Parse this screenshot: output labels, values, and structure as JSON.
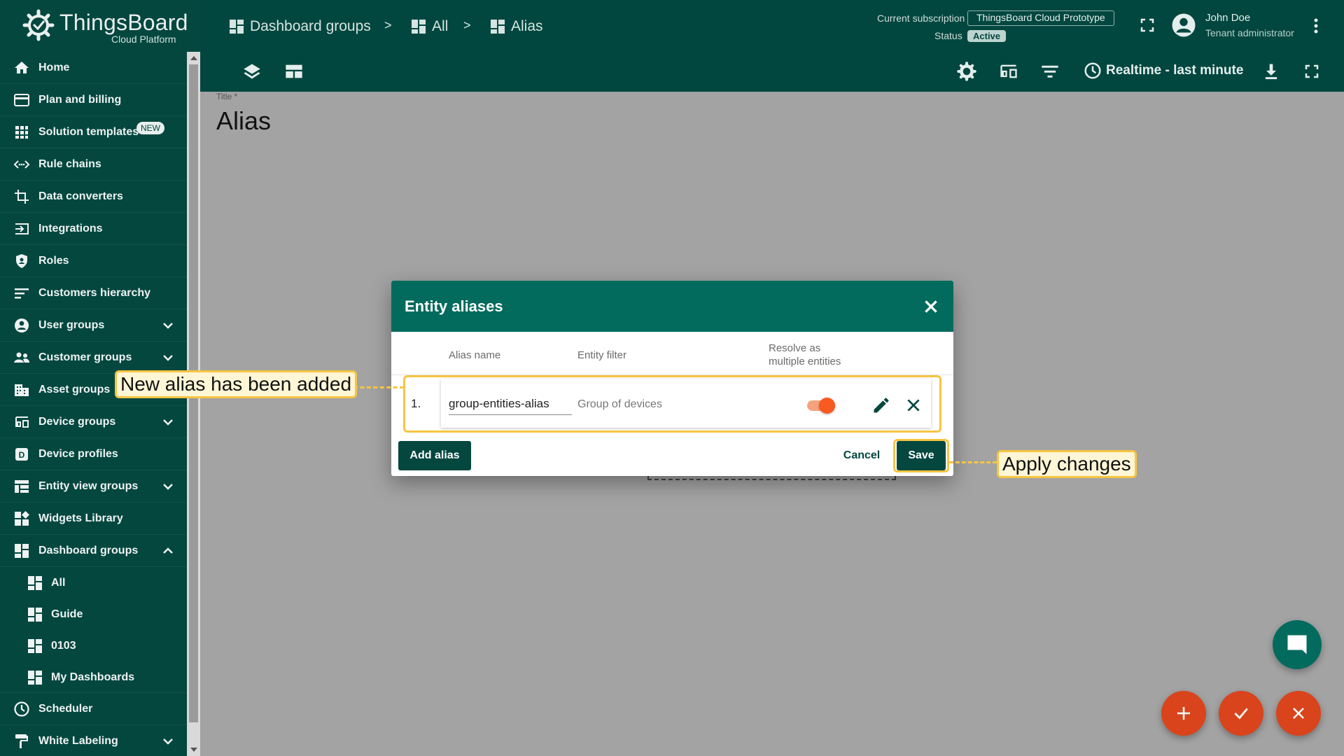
{
  "logo": {
    "name": "ThingsBoard",
    "subtitle": "Cloud Platform"
  },
  "sidebar": {
    "new_badge": "NEW",
    "items": [
      {
        "label": "Home",
        "icon": "home-icon"
      },
      {
        "label": "Plan and billing",
        "icon": "billing-icon"
      },
      {
        "label": "Solution templates",
        "icon": "apps-icon"
      },
      {
        "label": "Rule chains",
        "icon": "rule-chain-icon"
      },
      {
        "label": "Data converters",
        "icon": "converter-icon"
      },
      {
        "label": "Integrations",
        "icon": "integration-icon"
      },
      {
        "label": "Roles",
        "icon": "shield-icon"
      },
      {
        "label": "Customers hierarchy",
        "icon": "hierarchy-icon"
      },
      {
        "label": "User groups",
        "icon": "user-icon"
      },
      {
        "label": "Customer groups",
        "icon": "people-icon"
      },
      {
        "label": "Asset groups",
        "icon": "building-icon"
      },
      {
        "label": "Device groups",
        "icon": "devices-icon"
      },
      {
        "label": "Device profiles",
        "icon": "device-profile-icon"
      },
      {
        "label": "Entity view groups",
        "icon": "entity-view-icon"
      },
      {
        "label": "Widgets Library",
        "icon": "widgets-icon"
      },
      {
        "label": "Dashboard groups",
        "icon": "dashboard-icon"
      },
      {
        "label": "All",
        "icon": "dashboard-icon"
      },
      {
        "label": "Guide",
        "icon": "dashboard-icon"
      },
      {
        "label": "0103",
        "icon": "dashboard-icon"
      },
      {
        "label": "My Dashboards",
        "icon": "dashboard-icon"
      },
      {
        "label": "Scheduler",
        "icon": "clock-icon"
      },
      {
        "label": "White Labeling",
        "icon": "paint-roller-icon"
      }
    ]
  },
  "breadcrumb": [
    "Dashboard groups",
    "All",
    "Alias"
  ],
  "breadcrumb_separator": ">",
  "subscription": {
    "label": "Current subscription",
    "plan": "ThingsBoard Cloud Prototype",
    "status_label": "Status",
    "status": "Active"
  },
  "user": {
    "name": "John Doe",
    "role": "Tenant administrator"
  },
  "toolbar": {
    "timewindow": "Realtime - last minute"
  },
  "page": {
    "title_label": "Title *",
    "title": "Alias"
  },
  "dialog": {
    "title": "Entity aliases",
    "columns": {
      "alias_name": "Alias name",
      "entity_filter": "Entity filter",
      "resolve_line1": "Resolve as",
      "resolve_line2": "multiple entities"
    },
    "rows": [
      {
        "index": "1.",
        "alias_name": "group-entities-alias",
        "entity_filter": "Group of devices",
        "resolve_multiple": true
      }
    ],
    "add_label": "Add alias",
    "cancel_label": "Cancel",
    "save_label": "Save"
  },
  "callouts": {
    "added": "New alias has been added",
    "apply": "Apply changes"
  },
  "colors": {
    "primary": "#03473f",
    "dialog_header": "#036b5d",
    "accent": "#f95a1f",
    "fab": "#d9441c",
    "callout_border": "#f6c543"
  }
}
